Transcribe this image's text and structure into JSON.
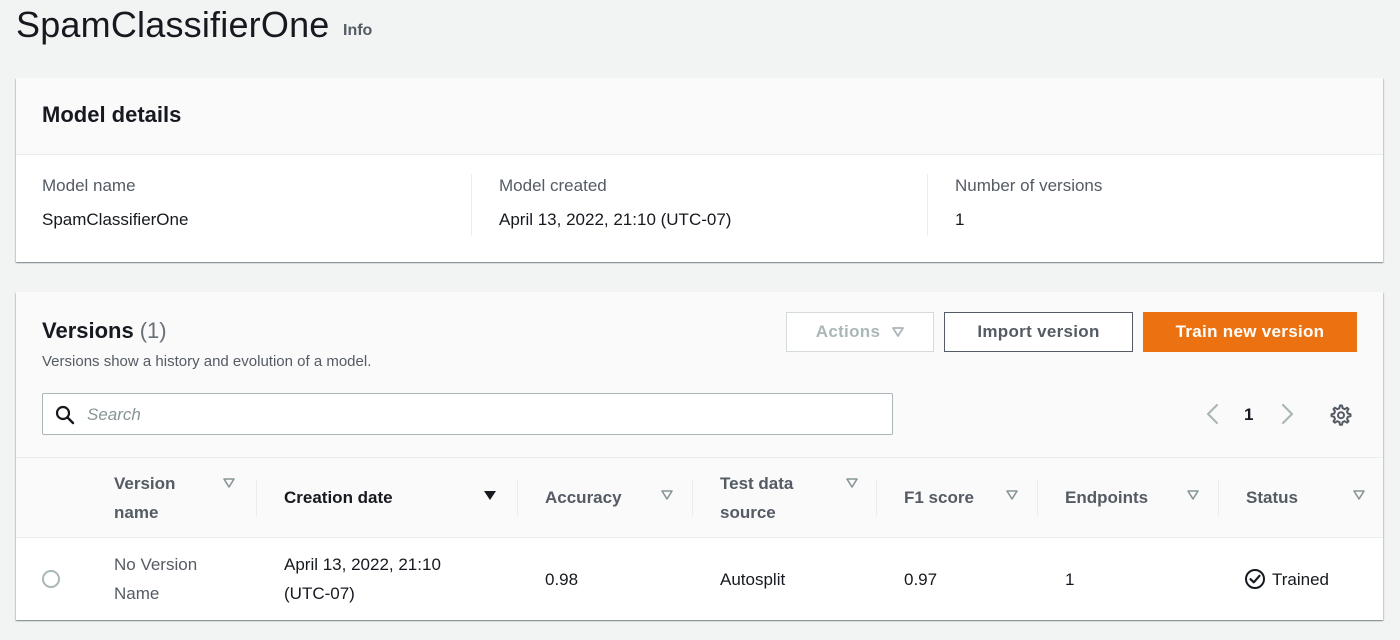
{
  "page": {
    "title": "SpamClassifierOne",
    "info_link": "Info"
  },
  "details": {
    "heading": "Model details",
    "fields": [
      {
        "label": "Model name",
        "value": "SpamClassifierOne"
      },
      {
        "label": "Model created",
        "value": "April 13, 2022, 21:10 (UTC-07)"
      },
      {
        "label": "Number of versions",
        "value": "1"
      }
    ]
  },
  "versions": {
    "heading": "Versions",
    "count": "(1)",
    "description": "Versions show a history and evolution of a model.",
    "actions_label": "Actions",
    "import_label": "Import version",
    "train_label": "Train new version",
    "search_placeholder": "Search",
    "search_value": "",
    "page_number": "1",
    "columns": [
      {
        "label": "Version name",
        "sorted": false
      },
      {
        "label": "Creation date",
        "sorted": true
      },
      {
        "label": "Accuracy",
        "sorted": false
      },
      {
        "label": "Test data source",
        "sorted": false
      },
      {
        "label": "F1 score",
        "sorted": false
      },
      {
        "label": "Endpoints",
        "sorted": false
      },
      {
        "label": "Status",
        "sorted": false
      }
    ],
    "rows": [
      {
        "selected": false,
        "version_name": "No Version Name",
        "creation_date": "April 13, 2022, 21:10 (UTC-07)",
        "accuracy": "0.98",
        "test_data_source": "Autosplit",
        "f1_score": "0.97",
        "endpoints": "1",
        "status": "Trained",
        "status_icon": "check-circle-icon"
      }
    ]
  },
  "colors": {
    "primary_button": "#ec7211",
    "page_background": "#f2f3f3",
    "text": "#16191f",
    "secondary_text": "#545b64"
  }
}
